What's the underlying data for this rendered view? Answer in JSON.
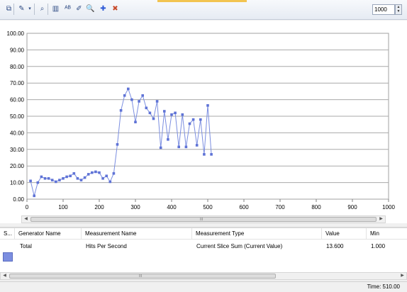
{
  "toolbar": {
    "buttons": [
      {
        "name": "copy-graph-button",
        "glyph": "⧉"
      },
      {
        "name": "chart-style-button",
        "glyph": "✎"
      },
      {
        "name": "chart-style-dropdown",
        "glyph": "▾"
      },
      {
        "name": "find-button",
        "glyph": "⌕"
      },
      {
        "name": "graph-properties-button",
        "glyph": "▥"
      },
      {
        "name": "spell-check-button",
        "glyph": "ᴬᴮ"
      },
      {
        "name": "edit-button",
        "glyph": "✐"
      },
      {
        "name": "zoom-button",
        "glyph": "🔍"
      },
      {
        "name": "add-counter-button",
        "glyph": "✚"
      },
      {
        "name": "delete-counter-button",
        "glyph": "✖"
      }
    ],
    "sample_count": "1000"
  },
  "chart_data": {
    "type": "line",
    "x": [
      10,
      20,
      30,
      40,
      50,
      60,
      70,
      80,
      90,
      100,
      110,
      120,
      130,
      140,
      150,
      160,
      170,
      180,
      190,
      200,
      210,
      220,
      230,
      240,
      250,
      260,
      270,
      280,
      290,
      300,
      310,
      320,
      330,
      340,
      350,
      360,
      370,
      380,
      390,
      400,
      410,
      420,
      430,
      440,
      450,
      460,
      470,
      480,
      490,
      500,
      510
    ],
    "values": [
      11.0,
      2.0,
      10.0,
      13.5,
      12.5,
      12.5,
      11.5,
      10.5,
      11.5,
      12.5,
      13.5,
      14.0,
      15.5,
      12.5,
      11.5,
      13.0,
      15.0,
      16.0,
      16.5,
      16.0,
      12.5,
      14.0,
      10.5,
      15.5,
      33.0,
      53.5,
      62.5,
      66.5,
      60.0,
      46.5,
      59.0,
      62.5,
      55.0,
      52.0,
      48.5,
      59.0,
      31.0,
      53.0,
      36.0,
      51.0,
      52.0,
      31.5,
      51.0,
      31.5,
      45.5,
      48.0,
      32.5,
      48.0,
      27.0,
      56.5,
      27.0
    ],
    "xlim": [
      0,
      1000
    ],
    "ylim": [
      0,
      100
    ],
    "xticks": [
      "0",
      "100",
      "200",
      "300",
      "400",
      "500",
      "600",
      "700",
      "800",
      "900",
      "1000"
    ],
    "yticks": [
      "0.00",
      "10.00",
      "20.00",
      "30.00",
      "40.00",
      "50.00",
      "60.00",
      "70.00",
      "80.00",
      "90.00",
      "100.00"
    ],
    "grid": true,
    "color": "#7b8ee0"
  },
  "table": {
    "columns": [
      "S...",
      "Generator Name",
      "Measurement Name",
      "Measurement Type",
      "Value",
      "Min"
    ],
    "rows": [
      {
        "color": "#7c8ee0",
        "generator": "Total",
        "measurement": "Hits Per Second",
        "type": "Current Slice Sum (Current Value)",
        "value": "13.600",
        "min": "1.000"
      }
    ]
  },
  "status": {
    "time": "Time: 510.00"
  },
  "scroll_grip": "III"
}
